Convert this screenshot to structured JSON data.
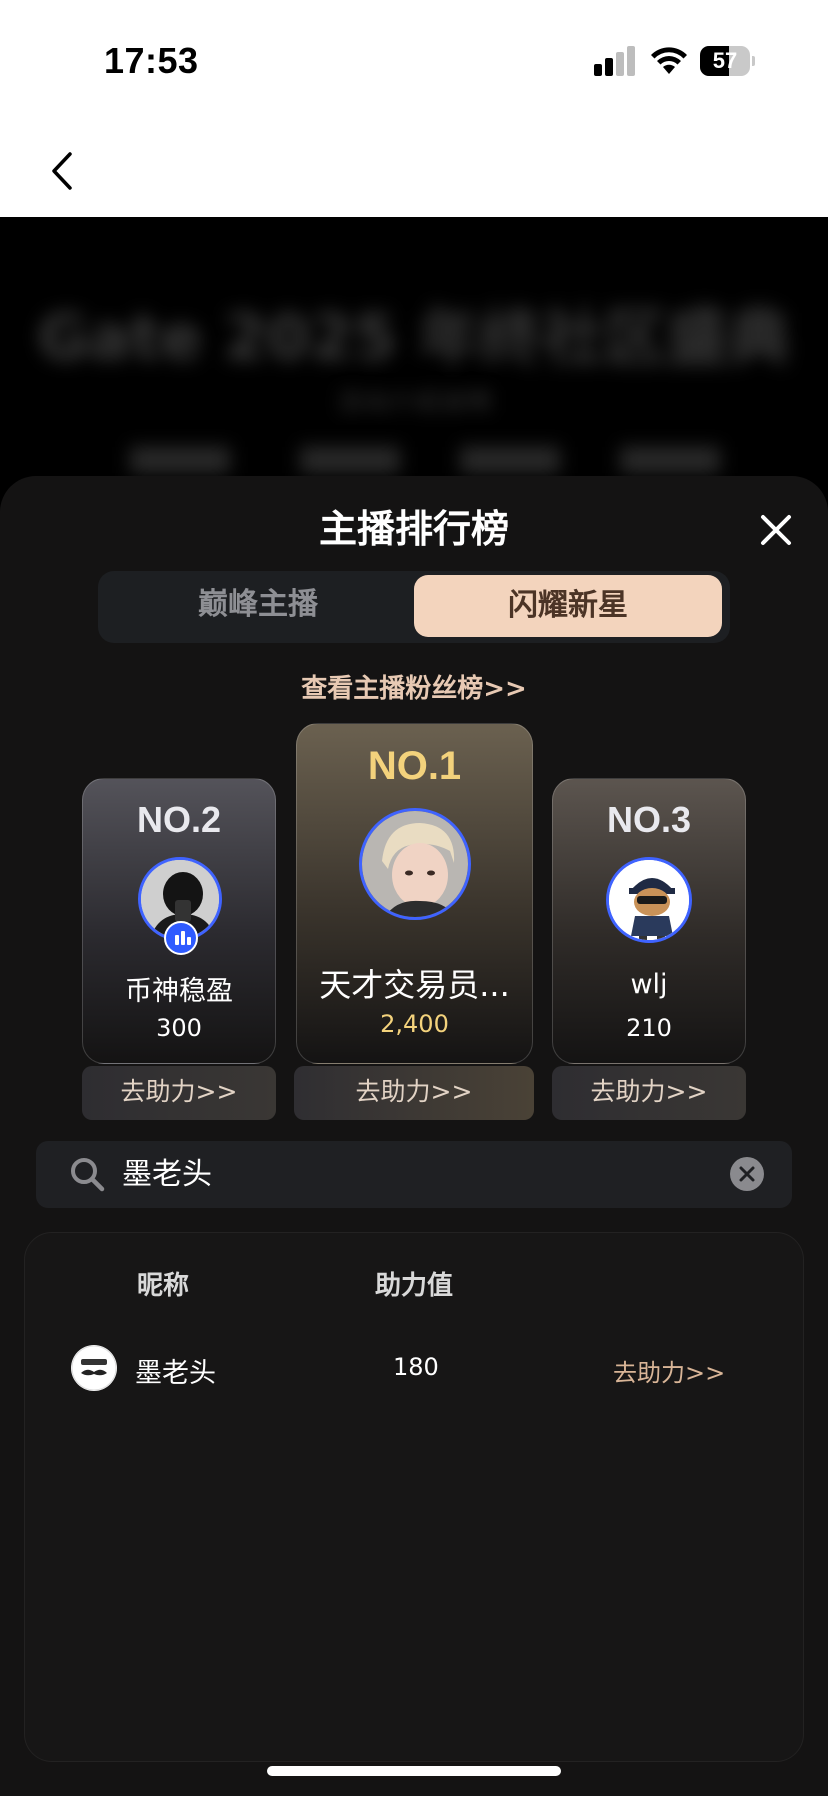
{
  "status_bar": {
    "time": "17:53",
    "battery": "57",
    "battery_level": 0.57
  },
  "background": {
    "title": "Gate 2025 年终社区盛典",
    "subtitle": "活动介绍说明"
  },
  "sheet": {
    "title": "主播排行榜",
    "tabs": [
      {
        "label": "巅峰主播",
        "active": false
      },
      {
        "label": "闪耀新星",
        "active": true
      }
    ],
    "fans_link": "查看主播粉丝榜>>"
  },
  "podium": [
    {
      "rank": "NO.2",
      "name": "币神稳盈",
      "score": "300",
      "help": "去助力>>",
      "live": true
    },
    {
      "rank": "NO.1",
      "name": "天才交易员...",
      "score": "2,400",
      "help": "去助力>>",
      "live": false
    },
    {
      "rank": "NO.3",
      "name": "wlj",
      "score": "210",
      "help": "去助力>>",
      "live": false
    }
  ],
  "search": {
    "value": "墨老头",
    "icon": "search-icon"
  },
  "table": {
    "headers": {
      "nickname": "昵称",
      "value": "助力值"
    },
    "rows": [
      {
        "nickname": "墨老头",
        "value": "180",
        "action": "去助力>>"
      }
    ]
  },
  "colors": {
    "accent": "#f3d4bd",
    "gold": "#f3d27c",
    "avatar_ring": "#3f63ff"
  }
}
